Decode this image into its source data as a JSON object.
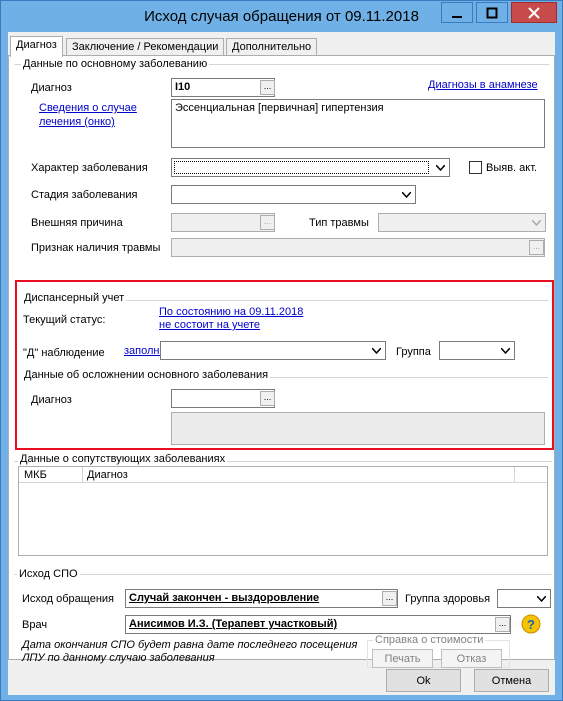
{
  "window": {
    "title": "Исход случая обращения от 09.11.2018"
  },
  "tabs": [
    {
      "label": "Диагноз"
    },
    {
      "label": "Заключение / Рекомендации"
    },
    {
      "label": "Дополнительно"
    }
  ],
  "main_disease": {
    "section_title": "Данные по основному заболеванию",
    "diagnosis_label": "Диагноз",
    "diagnosis_code": "I10",
    "anamnesis_link": "Диагнозы в анамнезе",
    "case_info_link_line1": "Сведения о случае",
    "case_info_link_line2": "лечения (онко)",
    "diagnosis_text": "Эссенциальная [первичная] гипертензия",
    "character_label": "Характер заболевания",
    "character_value": "",
    "detected_label": "Выяв. акт.",
    "stage_label": "Стадия заболевания",
    "stage_value": "",
    "external_cause_label": "Внешняя причина",
    "injury_type_label": "Тип травмы",
    "injury_sign_label": "Признак наличия травмы",
    "ellipsis": "..."
  },
  "dispensary": {
    "section_title": "Диспансерный учет",
    "current_status_label": "Текущий статус:",
    "status_date_link": "По состоянию на 09.11.2018",
    "status_value_link": "не состоит на учете",
    "observation_label": "\"Д\" наблюдение",
    "fill_link": "заполн.",
    "group_label": "Группа",
    "complication_title": "Данные об осложнении основного заболевания",
    "complication_diagnosis_label": "Диагноз"
  },
  "concomitant": {
    "section_title": "Данные о сопутствующих заболеваниях",
    "columns": [
      "МКБ",
      "Диагноз"
    ]
  },
  "outcome": {
    "section_title": "Исход СПО",
    "outcome_label": "Исход обращения",
    "outcome_value": "Случай закончен - выздоровление",
    "health_group_label": "Группа здоровья",
    "doctor_label": "Врач",
    "doctor_value": "Анисимов И.З. (Терапевт участковый)",
    "note_line1": "Дата окончания СПО будет равна дате последнего посещения",
    "note_line2": "ЛПУ по данному случаю заболевания",
    "cost_group_title": "Справка о стоимости",
    "print_button": "Печать",
    "refuse_button": "Отказ"
  },
  "footer": {
    "ok_button": "Ok",
    "cancel_button": "Отмена"
  },
  "colors": {
    "titlebar": "#6fb1e6",
    "close": "#c94a4a",
    "highlight": "#e81123",
    "link": "#0000cc"
  }
}
